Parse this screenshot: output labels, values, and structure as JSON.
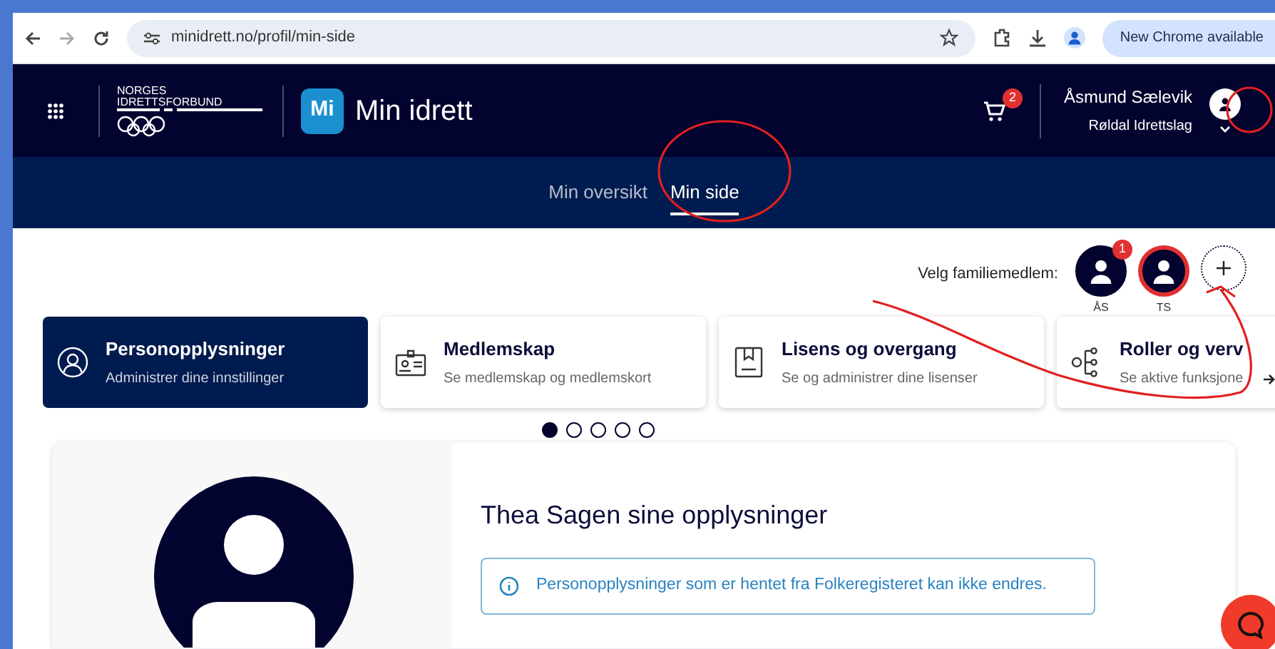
{
  "browser": {
    "url": "minidrett.no/profil/min-side",
    "update_button": "New Chrome available"
  },
  "header": {
    "org_logo": "NORGES IDRETTSFORBUND",
    "app_badge": "Mi",
    "app_name": "Min idrett",
    "cart_count": "2",
    "user_name": "Åsmund Sælevik",
    "user_club": "Røldal Idrettslag"
  },
  "tabs": [
    {
      "label": "Min oversikt",
      "selected": false
    },
    {
      "label": "Min side",
      "selected": true
    }
  ],
  "family": {
    "label": "Velg familiemedlem:",
    "members": [
      {
        "initials": "ÅS",
        "badge": "1",
        "selected": false
      },
      {
        "initials": "TS",
        "selected": true
      }
    ]
  },
  "cards": [
    {
      "title": "Personopplysninger",
      "subtitle": "Administrer dine innstillinger",
      "kind": "person",
      "selected": true
    },
    {
      "title": "Medlemskap",
      "subtitle": "Se medlemskap og medlemskort",
      "kind": "idcard",
      "selected": false
    },
    {
      "title": "Lisens og overgang",
      "subtitle": "Se og administrer dine lisenser",
      "kind": "document",
      "selected": false
    },
    {
      "title": "Roller og verv",
      "subtitle": "Se aktive funksjone",
      "kind": "roles",
      "selected": false
    }
  ],
  "carousel_dots": [
    {
      "selected": true
    },
    {
      "selected": false
    },
    {
      "selected": false
    },
    {
      "selected": false
    },
    {
      "selected": false
    }
  ],
  "profile": {
    "heading": "Thea Sagen sine opplysninger",
    "info": "Personopplysninger som er hentet fra Folkeregisteret kan ikke endres."
  }
}
